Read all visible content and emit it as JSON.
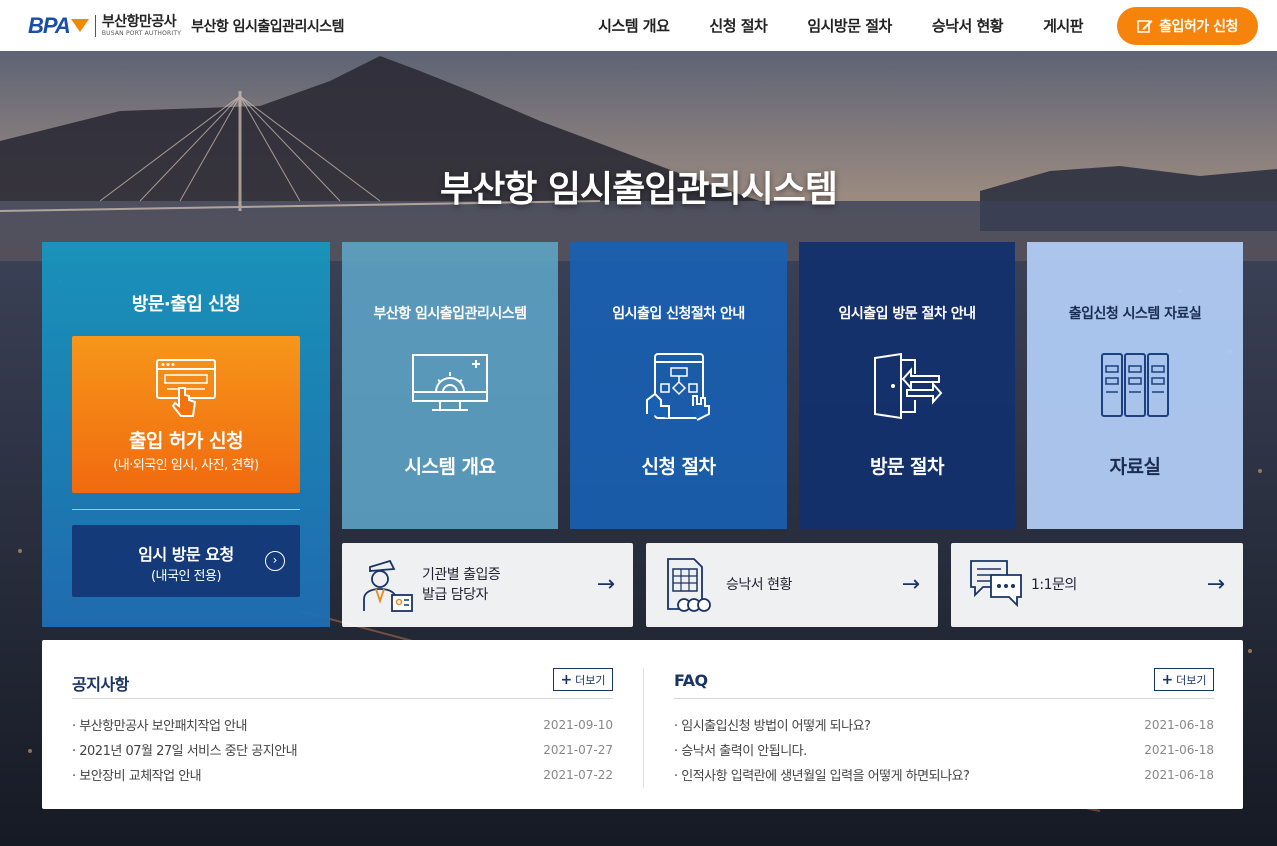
{
  "header": {
    "logo_bpa": "BPA",
    "logo_kr": "부산항만공사",
    "logo_en": "BUSAN PORT AUTHORITY",
    "system_title": "부산항 임시출입관리시스템",
    "nav": [
      "시스템 개요",
      "신청 절차",
      "임시방문 절차",
      "승낙서 현황",
      "게시판"
    ],
    "apply_button": "출입허가 신청"
  },
  "hero": {
    "title": "부산항 임시출입관리시스템"
  },
  "left_block": {
    "title": "방문·출입 신청",
    "orange_card": {
      "title": "출입 허가 신청",
      "subtitle": "(내·외국인 임시, 사진, 견학)"
    },
    "navy_card": {
      "title": "임시 방문 요청",
      "subtitle": "(내국인 전용)"
    }
  },
  "tiles": [
    {
      "top": "부산항 임시출입관리시스템",
      "bottom": "시스템 개요",
      "icon": "monitor-gear-icon"
    },
    {
      "top": "임시출입 신청절차 안내",
      "bottom": "신청 절차",
      "icon": "flowchart-hand-icon"
    },
    {
      "top": "임시출입 방문 절차 안내",
      "bottom": "방문 절차",
      "icon": "door-enter-icon"
    },
    {
      "top": "출입신청 시스템 자료실",
      "bottom": "자료실",
      "icon": "archive-binders-icon"
    }
  ],
  "small_cards": [
    {
      "line1": "기관별 출입증",
      "line2": "발급 담당자",
      "icon": "officer-id-icon"
    },
    {
      "line1": "승낙서 현황",
      "icon": "document-seal-icon"
    },
    {
      "line1": "1:1문의",
      "icon": "chat-bubbles-icon"
    }
  ],
  "notice": {
    "title": "공지사항",
    "more": "더보기",
    "items": [
      {
        "text": "· 부산항만공사 보안패치작업 안내",
        "date": "2021-09-10"
      },
      {
        "text": "· 2021년 07월 27일 서비스 중단 공지안내",
        "date": "2021-07-27"
      },
      {
        "text": "· 보안장비 교체작업 안내",
        "date": "2021-07-22"
      }
    ]
  },
  "faq": {
    "title": "FAQ",
    "more": "더보기",
    "items": [
      {
        "text": "· 임시출입신청 방법이 어떻게 되나요?",
        "date": "2021-06-18"
      },
      {
        "text": "· 승낙서 출력이 안됩니다.",
        "date": "2021-06-18"
      },
      {
        "text": "· 인적사항 입력란에 생년월일 입력을 어떻게 하면되나요?",
        "date": "2021-06-18"
      }
    ]
  },
  "colors": {
    "brand_blue": "#1a4ea8",
    "accent_orange": "#f6830c",
    "navy": "#143a7a"
  }
}
